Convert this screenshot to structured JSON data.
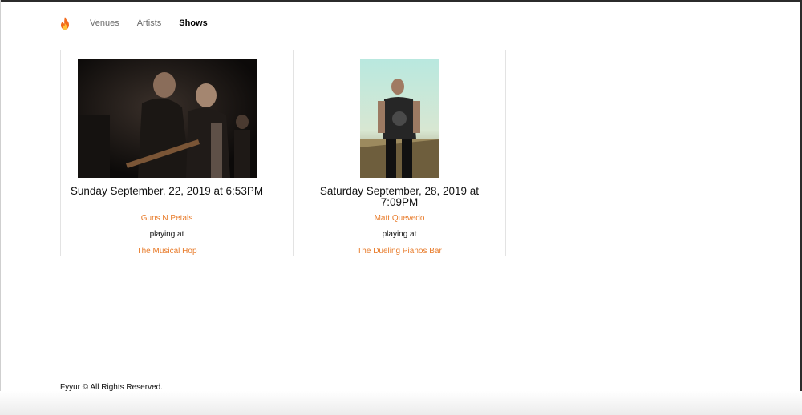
{
  "nav": {
    "brand_icon": "fire-icon",
    "links": [
      {
        "label": "Venues",
        "active": false
      },
      {
        "label": "Artists",
        "active": false
      },
      {
        "label": "Shows",
        "active": true
      }
    ]
  },
  "shows": [
    {
      "date": "Sunday September, 22, 2019 at 6:53PM",
      "artist": "Guns N Petals",
      "playing_label": "playing at",
      "venue": "The Musical Hop"
    },
    {
      "date": "Saturday September, 28, 2019 at 7:09PM",
      "artist": "Matt Quevedo",
      "playing_label": "playing at",
      "venue": "The Dueling Pianos Bar"
    }
  ],
  "footer": {
    "text": "Fyyur © All Rights Reserved."
  },
  "colors": {
    "link": "#e87b2a",
    "nav_inactive": "#6b6b6b"
  }
}
